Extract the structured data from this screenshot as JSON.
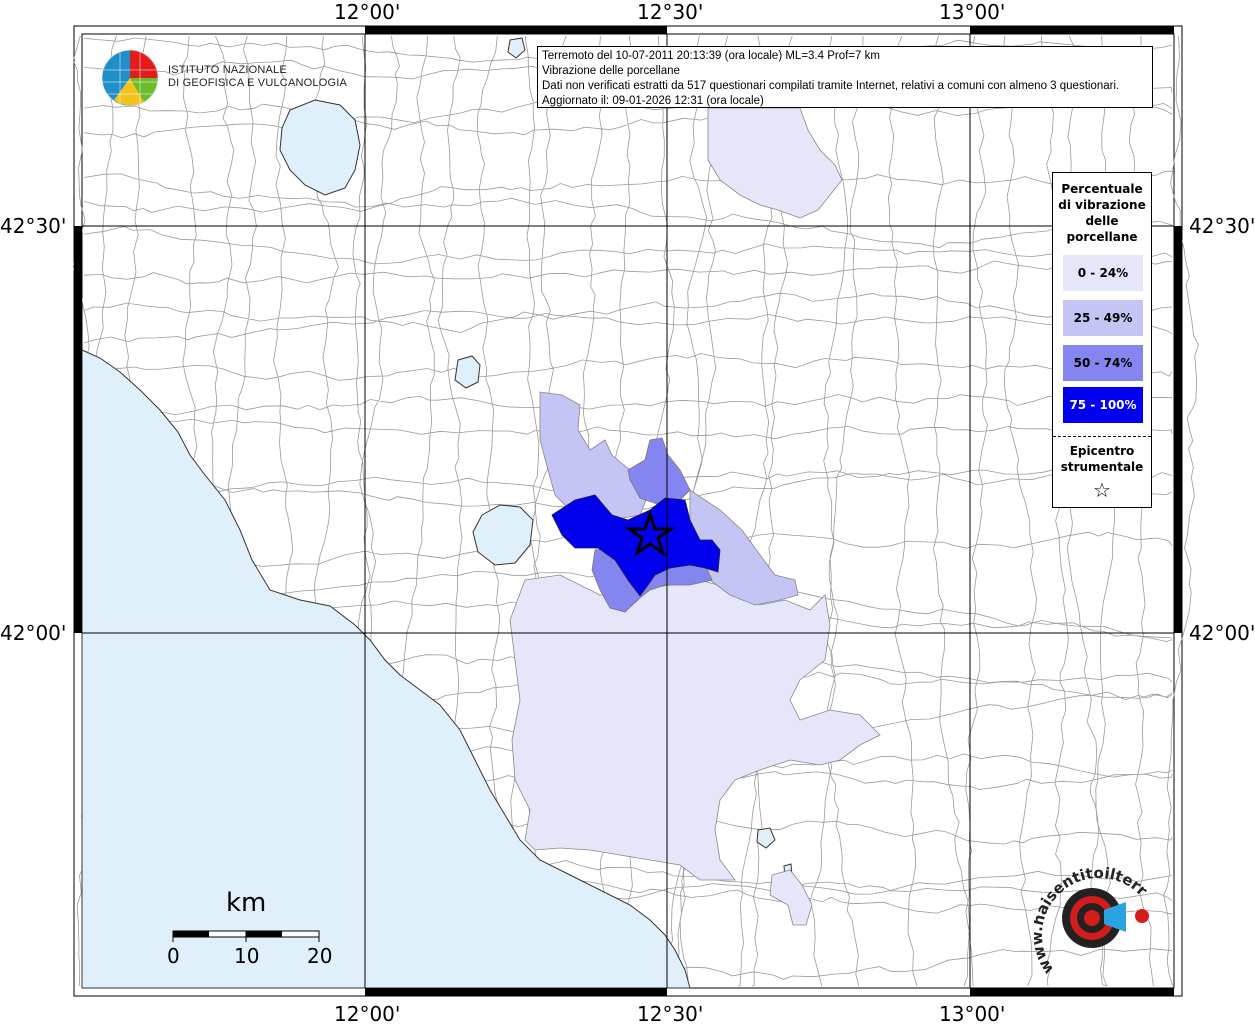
{
  "map": {
    "title_lines": [
      "Terremoto del 10-07-2011 20:13:39 (ora locale) ML=3.4 Prof=7 km",
      "Vibrazione delle porcellane",
      "Dati non verificati estratti da 517 questionari compilati tramite Internet, relativi a comuni con almeno 3 questionari.",
      "Aggiornato il: 09-01-2026 12:31 (ora locale)"
    ],
    "lon_labels": [
      "12°00'",
      "12°30'",
      "13°00'"
    ],
    "lat_labels": [
      "42°30'",
      "42°00'"
    ]
  },
  "legend": {
    "title": [
      "Percentuale",
      "di vibrazione",
      "delle",
      "porcellane"
    ],
    "classes": [
      {
        "label": "0 - 24%",
        "color": "#e6e6fb",
        "text_color": "#000000"
      },
      {
        "label": "25 - 49%",
        "color": "#c4c4f5",
        "text_color": "#000000"
      },
      {
        "label": "50 - 74%",
        "color": "#8585ef",
        "text_color": "#000000"
      },
      {
        "label": "75 - 100%",
        "color": "#0000ee",
        "text_color": "#ffffff"
      }
    ],
    "epicenter_label": [
      "Epicentro",
      "strumentale"
    ],
    "epicenter_symbol": "☆"
  },
  "institute": {
    "name_line1": "ISTITUTO NAZIONALE",
    "name_line2": "DI GEOFISICA E VULCANOLOGIA"
  },
  "scale": {
    "unit": "km",
    "ticks": [
      "0",
      "10",
      "20"
    ]
  },
  "sentito": {
    "url_text": "www.haisentitoilterremoto.it"
  },
  "colors": {
    "sea": "#dff0fb",
    "lake": "#dff0fb",
    "land": "#ffffff",
    "border": "#9a9a9a"
  }
}
